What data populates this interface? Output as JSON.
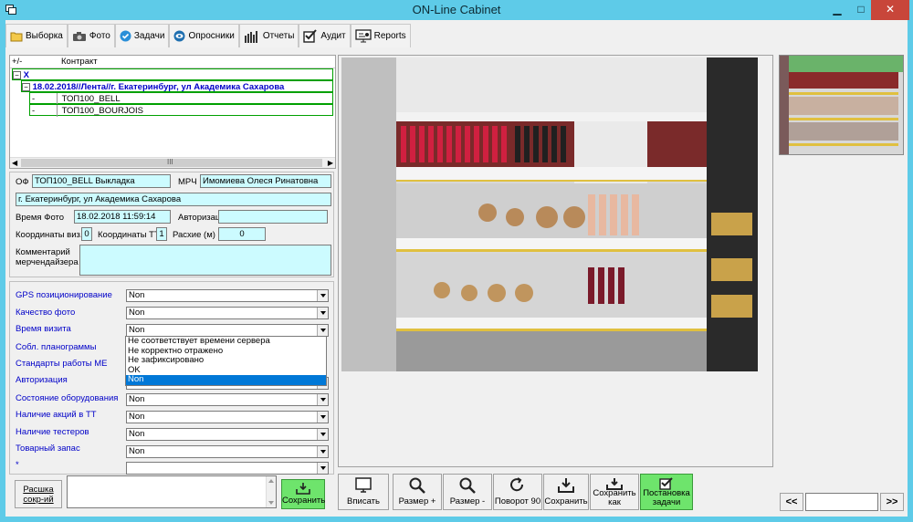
{
  "window": {
    "title": "ON-Line Cabinet",
    "minimize": "▁",
    "maximize": "□",
    "close": "✕"
  },
  "toolbar": {
    "items": [
      {
        "label": "Выборка",
        "icon": "folder-icon"
      },
      {
        "label": "Фото",
        "icon": "camera-icon"
      },
      {
        "label": "Задачи",
        "icon": "check-circle-icon"
      },
      {
        "label": "Опросники",
        "icon": "eye-icon"
      },
      {
        "label": "Отчеты",
        "icon": "bar-chart-icon"
      },
      {
        "label": "Аудит",
        "icon": "checkbox-icon"
      },
      {
        "label": "Reports",
        "icon": "presentation-icon"
      }
    ]
  },
  "tree": {
    "columns": [
      "+/-",
      "Контракт"
    ],
    "group": "X",
    "node": "18.02.2018//Лента//г. Екатеринбург, ул Академика Сахарова",
    "leaves": [
      {
        "mark": "-",
        "name": "ТОП100_BELL"
      },
      {
        "mark": "-",
        "name": "ТОП100_BOURJOIS"
      }
    ],
    "scroll_label": "III"
  },
  "info": {
    "of_label": "ОФ",
    "of_value": "ТОП100_BELL Выкладка",
    "mrch_label": "МРЧ",
    "mrch_value": "Имомиева Олеся Ринатовна",
    "address": "г. Екатеринбург, ул Академика Сахарова",
    "photo_time_label": "Время Фото",
    "photo_time_value": "18.02.2018 11:59:14",
    "author_label": "Авторизация",
    "author_value": "",
    "coords_viz_label": "Координаты виз.",
    "coords_viz_value": "0",
    "coords_tt_label": "Координаты ТТ",
    "coords_tt_value": "1",
    "distance_label": "Расхие (м)",
    "distance_value": "0",
    "comment_label_1": "Комментарий",
    "comment_label_2": "мерчендайзера",
    "comment_value": ""
  },
  "checks": [
    {
      "label": "GPS позиционирование",
      "value": "Non"
    },
    {
      "label": "Качество фото",
      "value": "Non"
    },
    {
      "label": "Время визита",
      "value": "Non"
    },
    {
      "label": "Собл. планограммы",
      "value": ""
    },
    {
      "label": "Стандарты работы МЕ",
      "value": ""
    },
    {
      "label": "Авторизация",
      "value": ""
    },
    {
      "label": "Состояние оборудования",
      "value": "Non"
    },
    {
      "label": "Наличие акций в ТТ",
      "value": "Non"
    },
    {
      "label": "Наличие тестеров",
      "value": "Non"
    },
    {
      "label": "Товарный запас",
      "value": "Non"
    },
    {
      "label": "*",
      "value": ""
    }
  ],
  "dropdown": {
    "options": [
      "Не соответствует времени сервера",
      "Не корректно отражено",
      "Не зафиксировано",
      "OK",
      "Non"
    ],
    "selected": "Non"
  },
  "bottom_left": {
    "rasshifrovka_1": "Расшка",
    "rasshifrovka_2": "сокр-ий",
    "save_label": "Сохранить"
  },
  "photo_toolbar": [
    {
      "label": "Вписать",
      "icon": "monitor-icon"
    },
    {
      "label": "Размер +",
      "icon": "zoom-in-icon"
    },
    {
      "label": "Размер -",
      "icon": "zoom-out-icon"
    },
    {
      "label": "Поворот 90",
      "icon": "rotate-icon"
    },
    {
      "label": "Сохранить",
      "icon": "save-icon"
    },
    {
      "label": "Сохранить как",
      "label_1": "Сохранить",
      "label_2": "как",
      "icon": "save-as-icon"
    },
    {
      "label": "Постановка задачи",
      "label_1": "Постановка",
      "label_2": "задачи",
      "icon": "task-icon"
    }
  ],
  "pager": {
    "prev": "<<",
    "next": ">>",
    "value": ""
  },
  "colors": {
    "title_bar": "#5ecbe8",
    "field_fill": "#ccfbff",
    "tree_highlight": "#00a000",
    "label_blue": "#0000c8",
    "save_green": "#6ee46c",
    "selection": "#0078d7"
  }
}
